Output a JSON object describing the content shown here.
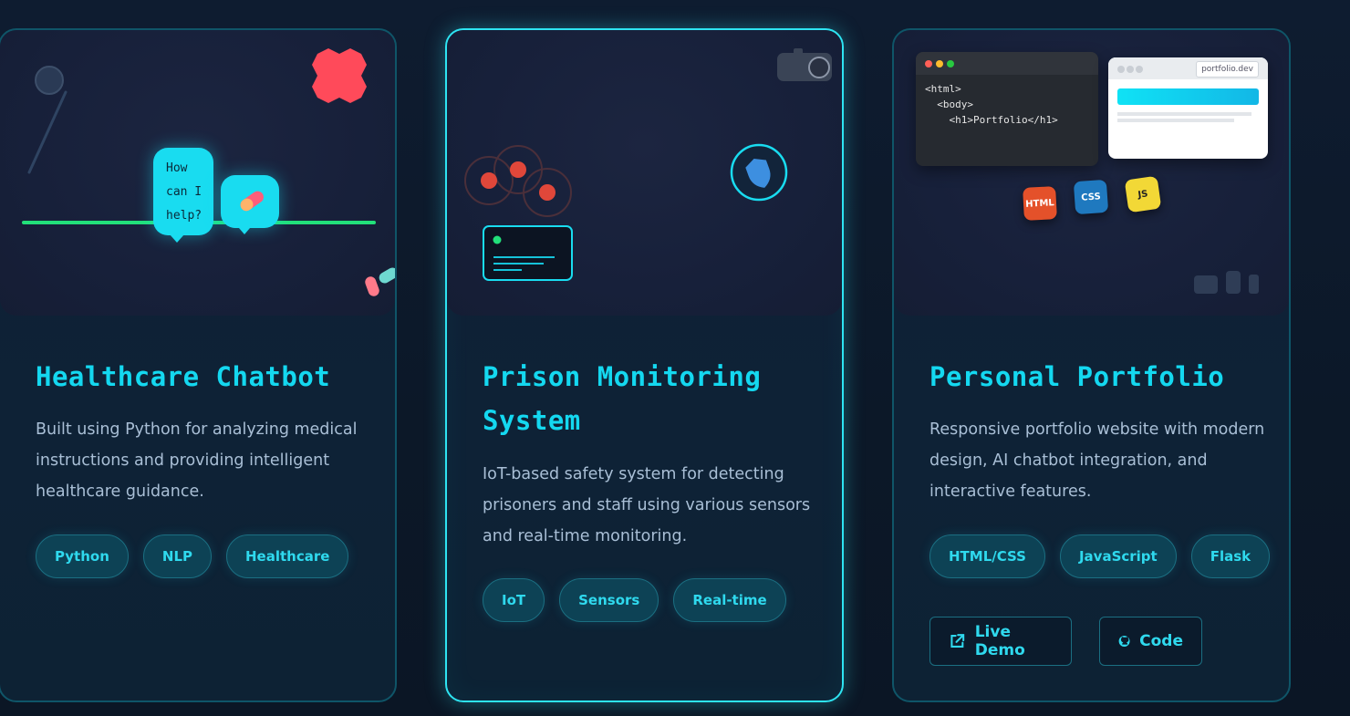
{
  "cards": [
    {
      "title": "Healthcare Chatbot",
      "description": "Built using Python for analyzing medical instructions and providing intelligent healthcare guidance.",
      "tags": [
        "Python",
        "NLP",
        "Healthcare"
      ],
      "illustration": {
        "bubble_text": "How can I help?"
      }
    },
    {
      "title": "Prison Monitoring System",
      "description": "IoT-based safety system for detecting prisoners and staff using various sensors and real-time monitoring.",
      "tags": [
        "IoT",
        "Sensors",
        "Real-time"
      ]
    },
    {
      "title": "Personal Portfolio",
      "description": "Responsive portfolio website with modern design, AI chatbot integration, and interactive features.",
      "tags": [
        "HTML/CSS",
        "JavaScript",
        "Flask"
      ],
      "buttons": {
        "live_demo": "Live Demo",
        "code": "Code"
      },
      "illustration": {
        "code_lines": [
          "<html>",
          "  <body>",
          "    <h1>Portfolio</h1>"
        ],
        "browser_url": "portfolio.dev",
        "badges": [
          "HTML",
          "CSS",
          "JS"
        ]
      }
    }
  ],
  "colors": {
    "accent": "#14d8f0",
    "tag_bg": "#0d4255",
    "active_border": "#2ee4f2",
    "card_border": "#0f5568"
  }
}
